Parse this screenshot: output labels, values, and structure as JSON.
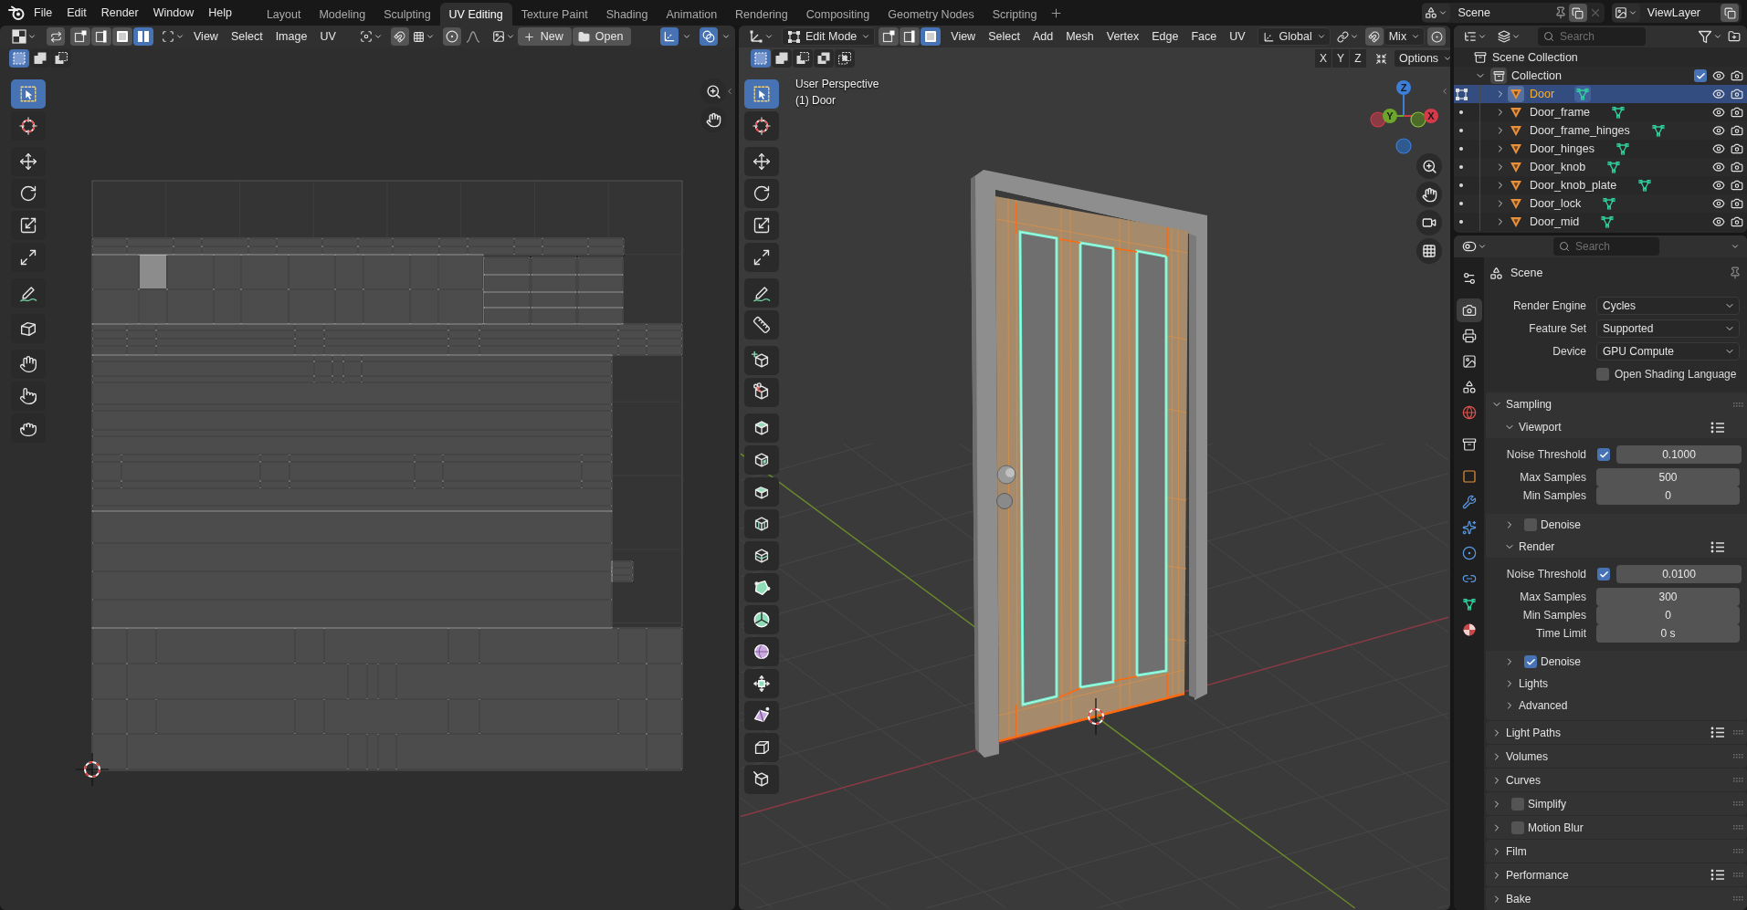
{
  "top_bar": {
    "menus": [
      "File",
      "Edit",
      "Render",
      "Window",
      "Help"
    ],
    "workspaces": [
      {
        "label": "Layout",
        "selected": false
      },
      {
        "label": "Modeling",
        "selected": false
      },
      {
        "label": "Sculpting",
        "selected": false
      },
      {
        "label": "UV Editing",
        "selected": true
      },
      {
        "label": "Texture Paint",
        "selected": false
      },
      {
        "label": "Shading",
        "selected": false
      },
      {
        "label": "Animation",
        "selected": false
      },
      {
        "label": "Rendering",
        "selected": false
      },
      {
        "label": "Compositing",
        "selected": false
      },
      {
        "label": "Geometry Nodes",
        "selected": false
      },
      {
        "label": "Scripting",
        "selected": false
      }
    ],
    "scene": "Scene",
    "view_layer": "ViewLayer"
  },
  "uv_editor": {
    "select_modes": [
      {
        "kind": "vertex",
        "selected": false
      },
      {
        "kind": "edge",
        "selected": false
      },
      {
        "kind": "face",
        "selected": false
      },
      {
        "kind": "island",
        "selected": true
      }
    ],
    "menus": [
      "View",
      "Select",
      "Image",
      "UV"
    ],
    "snap_on": false,
    "new_label": "New",
    "open_label": "Open",
    "gizmos_on": true,
    "overlays_on": true,
    "box_modes": [
      {
        "kind": "set",
        "selected": true
      },
      {
        "kind": "extend",
        "selected": false
      },
      {
        "kind": "subtract",
        "selected": false
      }
    ],
    "tools": [
      [
        {
          "kind": "select",
          "selected": true
        },
        {
          "kind": "cursor",
          "selected": false
        }
      ],
      [
        {
          "kind": "move",
          "selected": false
        },
        {
          "kind": "rotate",
          "selected": false
        },
        {
          "kind": "scale",
          "selected": false
        },
        {
          "kind": "transform",
          "selected": false
        }
      ],
      [
        {
          "kind": "annotate",
          "selected": false
        }
      ],
      [
        {
          "kind": "uvrip",
          "selected": false
        }
      ],
      [
        {
          "kind": "grab",
          "selected": false
        },
        {
          "kind": "relax",
          "selected": false
        },
        {
          "kind": "pinch",
          "selected": false
        }
      ]
    ]
  },
  "viewport": {
    "mode": "Edit Mode",
    "select_modes": [
      {
        "kind": "vertex",
        "selected": false
      },
      {
        "kind": "edge",
        "selected": false
      },
      {
        "kind": "face",
        "selected": true
      }
    ],
    "menus": [
      "View",
      "Select",
      "Add",
      "Mesh",
      "Vertex",
      "Edge",
      "Face",
      "UV"
    ],
    "orientation": "Global",
    "snap_on": false,
    "snap_menu": "Mix",
    "box_modes": [
      {
        "kind": "set",
        "selected": true
      },
      {
        "kind": "extend",
        "selected": false
      },
      {
        "kind": "subtract",
        "selected": false
      },
      {
        "kind": "difference",
        "selected": false
      },
      {
        "kind": "intersect",
        "selected": false
      }
    ],
    "axes": [
      {
        "label": "X",
        "on": false
      },
      {
        "label": "Y",
        "on": false
      },
      {
        "label": "Z",
        "on": false
      }
    ],
    "options": "Options",
    "view_name": "User Perspective",
    "object_name": "(1) Door",
    "gizmo_axes": [
      "Z",
      "Y",
      "X"
    ],
    "tools": [
      [
        {
          "kind": "select",
          "selected": true
        },
        {
          "kind": "cursor",
          "selected": false
        }
      ],
      [
        {
          "kind": "move",
          "selected": false
        },
        {
          "kind": "rotate",
          "selected": false
        },
        {
          "kind": "scale",
          "selected": false
        },
        {
          "kind": "transform",
          "selected": false
        }
      ],
      [
        {
          "kind": "annotate",
          "selected": false
        },
        {
          "kind": "measure",
          "selected": false
        }
      ],
      [
        {
          "kind": "addcube",
          "selected": false
        },
        {
          "kind": "cutcube",
          "selected": false
        }
      ],
      [
        {
          "kind": "extrude",
          "selected": false
        },
        {
          "kind": "inset",
          "selected": false
        },
        {
          "kind": "bevel",
          "selected": false
        },
        {
          "kind": "loopcut",
          "selected": false
        },
        {
          "kind": "knife",
          "selected": false
        },
        {
          "kind": "polybuild",
          "selected": false
        },
        {
          "kind": "spin",
          "selected": false
        },
        {
          "kind": "smooth",
          "selected": false
        },
        {
          "kind": "slide",
          "selected": false
        },
        {
          "kind": "shrink",
          "selected": false
        },
        {
          "kind": "shear",
          "selected": false
        },
        {
          "kind": "rip",
          "selected": false
        }
      ]
    ]
  },
  "outliner": {
    "search_placeholder": "Search",
    "root": "Scene Collection",
    "collection": {
      "name": "Collection",
      "expanded": true,
      "checked": true,
      "children": [
        {
          "name": "Door",
          "selected": true,
          "editing": true
        },
        {
          "name": "Door_frame",
          "selected": false,
          "editing": false
        },
        {
          "name": "Door_frame_hinges",
          "selected": false,
          "editing": false
        },
        {
          "name": "Door_hinges",
          "selected": false,
          "editing": false
        },
        {
          "name": "Door_knob",
          "selected": false,
          "editing": false
        },
        {
          "name": "Door_knob_plate",
          "selected": false,
          "editing": false
        },
        {
          "name": "Door_lock",
          "selected": false,
          "editing": false
        },
        {
          "name": "Door_mid",
          "selected": false,
          "editing": false
        }
      ]
    }
  },
  "properties": {
    "search_placeholder": "Search",
    "tabs": [
      {
        "kind": "tool",
        "selected": false
      },
      {
        "kind": "render",
        "selected": true
      },
      {
        "kind": "output",
        "selected": false
      },
      {
        "kind": "viewlayer",
        "selected": false
      },
      {
        "kind": "scene",
        "selected": false
      },
      {
        "kind": "world",
        "selected": false
      },
      {
        "kind": "collection",
        "selected": false
      },
      {
        "kind": "object",
        "selected": false
      },
      {
        "kind": "modifiers",
        "selected": false
      },
      {
        "kind": "particles",
        "selected": false
      },
      {
        "kind": "physics",
        "selected": false
      },
      {
        "kind": "constraints",
        "selected": false
      },
      {
        "kind": "data",
        "selected": false
      },
      {
        "kind": "material",
        "selected": false
      }
    ],
    "context": "Scene",
    "settings": [
      {
        "label": "Render Engine",
        "value": "Cycles"
      },
      {
        "label": "Feature Set",
        "value": "Supported"
      },
      {
        "label": "Device",
        "value": "GPU Compute"
      }
    ],
    "osl": {
      "label": "Open Shading Language",
      "checked": false
    },
    "panels": [
      {
        "title": "Sampling",
        "expanded": true,
        "subpanels": [
          {
            "title": "Viewport",
            "expanded": true,
            "presets": true,
            "rows": [
              {
                "label": "Noise Threshold",
                "value": "0.1000",
                "checked": true
              },
              {
                "label": "Max Samples",
                "value": "500"
              },
              {
                "label": "Min Samples",
                "value": "0"
              }
            ]
          },
          {
            "title": "Denoise",
            "expanded": false,
            "checked": false
          },
          {
            "title": "Render",
            "expanded": true,
            "presets": true,
            "rows": [
              {
                "label": "Noise Threshold",
                "value": "0.0100",
                "checked": true
              },
              {
                "label": "Max Samples",
                "value": "300"
              },
              {
                "label": "Min Samples",
                "value": "0"
              },
              {
                "label": "Time Limit",
                "value": "0 s"
              }
            ]
          },
          {
            "title": "Denoise",
            "expanded": false,
            "checked": true
          },
          {
            "title": "Lights",
            "expanded": false
          },
          {
            "title": "Advanced",
            "expanded": false
          }
        ]
      },
      {
        "title": "Light Paths",
        "expanded": false,
        "presets": true
      },
      {
        "title": "Volumes",
        "expanded": false
      },
      {
        "title": "Curves",
        "expanded": false
      },
      {
        "title": "Simplify",
        "expanded": false,
        "checked": false
      },
      {
        "title": "Motion Blur",
        "expanded": false,
        "checked": false
      },
      {
        "title": "Film",
        "expanded": false
      },
      {
        "title": "Performance",
        "expanded": false,
        "presets": true
      },
      {
        "title": "Bake",
        "expanded": false
      }
    ]
  }
}
